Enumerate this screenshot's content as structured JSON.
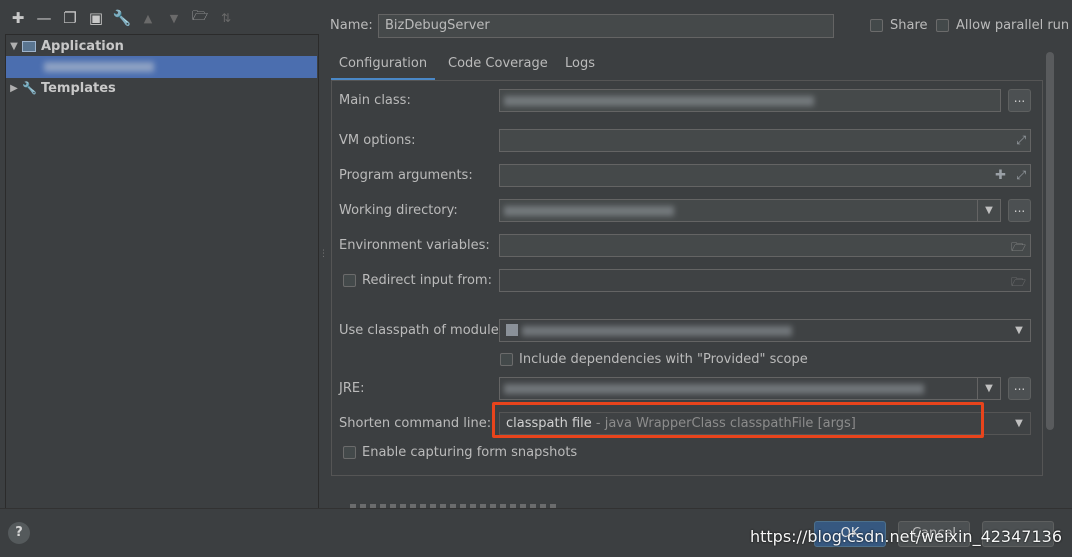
{
  "toolbar": {
    "icons": [
      "add-icon",
      "remove-icon",
      "copy-icon",
      "save-icon",
      "wrench-icon",
      "move-up-icon",
      "move-down-icon",
      "folder-icon",
      "sort-icon"
    ]
  },
  "tree": {
    "application_label": "Application",
    "templates_label": "Templates"
  },
  "header": {
    "name_label": "Name:",
    "name_value": "BizDebugServer",
    "share_label": "Share",
    "allow_parallel_label": "Allow parallel run"
  },
  "tabs": [
    {
      "label": "Configuration",
      "active": true
    },
    {
      "label": "Code Coverage",
      "active": false
    },
    {
      "label": "Logs",
      "active": false
    }
  ],
  "form": {
    "main_class_label": "Main class:",
    "vm_options_label": "VM options:",
    "program_arguments_label": "Program arguments:",
    "working_directory_label": "Working directory:",
    "environment_variables_label": "Environment variables:",
    "redirect_input_label": "Redirect input from:",
    "classpath_module_label": "Use classpath of module:",
    "include_dependencies_label": "Include dependencies with \"Provided\" scope",
    "jre_label": "JRE:",
    "shorten_label": "Shorten command line:",
    "shorten_value_main": "classpath file",
    "shorten_value_hint": " - java WrapperClass classpathFile [args]",
    "enable_capturing_label": "Enable capturing form snapshots",
    "browse_label": "..."
  },
  "footer": {
    "help_label": "?",
    "ok_label": "OK",
    "cancel_label": "Cancel",
    "watermark": "https://blog.csdn.net/weixin_42347136"
  },
  "colors": {
    "background": "#3c3f41",
    "selection": "#4b6eaf",
    "highlight": "#e8441c",
    "ok_button": "#365880"
  }
}
